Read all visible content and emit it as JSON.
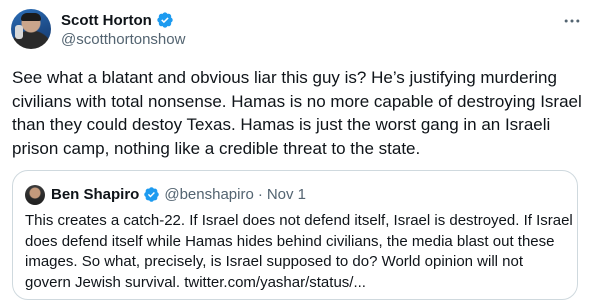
{
  "author": {
    "name": "Scott Horton",
    "handle": "@scotthortonshow",
    "verified_color": "#1d9bf0"
  },
  "tweet": {
    "text": "See what a blatant and obvious liar this guy is? He’s justifying murdering civilians with total nonsense. Hamas is no more capable of destroying Israel than they could destoy Texas. Hamas is just the worst gang in an Israeli prison camp, nothing like a credible threat to the state."
  },
  "quoted": {
    "name": "Ben Shapiro",
    "handle": "@benshapiro",
    "separator": "·",
    "date": "Nov 1",
    "text": "This creates a catch-22. If Israel does not defend itself, Israel is destroyed. If Israel does defend itself while Hamas hides behind civilians, the media blast out these images. So what, precisely, is Israel supposed to do? World opinion will not govern Jewish survival. twitter.com/yashar/status/..."
  },
  "icons": {
    "more": "more-horizontal-icon",
    "verified": "verified-badge-icon"
  }
}
